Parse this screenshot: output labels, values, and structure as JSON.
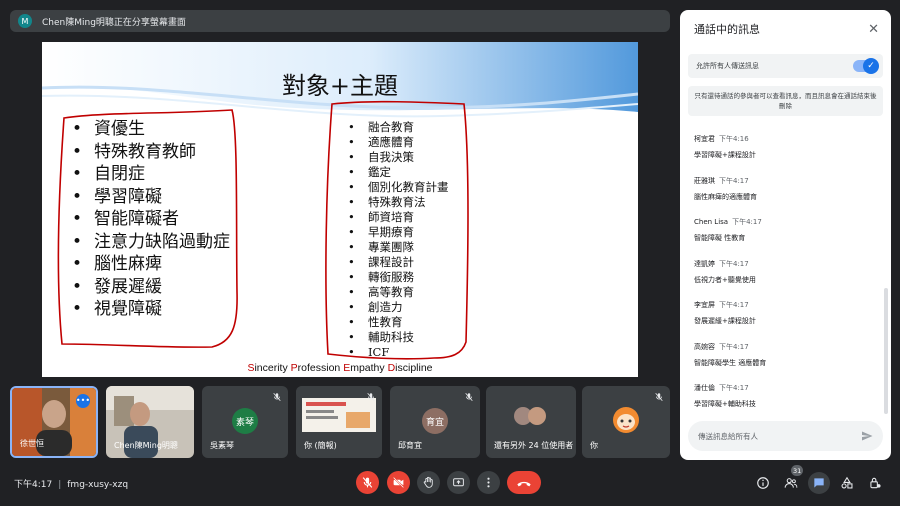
{
  "presenter": {
    "initial": "M",
    "text": "Chen陳Ming明聰正在分享螢幕畫面"
  },
  "slide": {
    "title": "對象+主題",
    "left_items": [
      "資優生",
      "特殊教育教師",
      "自閉症",
      "學習障礙",
      "智能障礙者",
      "注意力缺陷過動症",
      "腦性麻痺",
      "發展遲緩",
      "視覺障礙"
    ],
    "right_items": [
      "融合教育",
      "適應體育",
      "自我決策",
      "鑑定",
      "個別化教育計畫",
      "特殊教育法",
      "師資培育",
      "早期療育",
      "專業團隊",
      "課程設計",
      "轉銜服務",
      "高等教育",
      "創造力",
      "性教育",
      "輔助科技",
      "ICF"
    ],
    "footer": [
      {
        "initial": "S",
        "rest": "incerity"
      },
      {
        "initial": "P",
        "rest": "rofession"
      },
      {
        "initial": "E",
        "rest": "mpathy"
      },
      {
        "initial": "D",
        "rest": "iscipline"
      }
    ]
  },
  "chat": {
    "title": "通話中的訊息",
    "toggle_label": "允許所有人傳送訊息",
    "toggle_on": true,
    "notice": "只有還待通話的參與者可以查看訊息，而且訊息會在通話結束後刪除",
    "messages": [
      {
        "sender": "柯宜君",
        "time": "下午4:16",
        "text": "學習障礙+課程設計"
      },
      {
        "sender": "莊雅琪",
        "time": "下午4:17",
        "text": "腦性麻痺的適應體育"
      },
      {
        "sender": "Chen Lisa",
        "time": "下午4:17",
        "text": "智能障礙 性教育"
      },
      {
        "sender": "達凱婷",
        "time": "下午4:17",
        "text": "低視力者+聽覺使用"
      },
      {
        "sender": "李宜屏",
        "time": "下午4:17",
        "text": "發展遲緩+課程設計"
      },
      {
        "sender": "高婉容",
        "time": "下午4:17",
        "text": "智能障礙學生 適應體育"
      },
      {
        "sender": "潘仕倫",
        "time": "下午4:17",
        "text": "學習障礙+輔助科技"
      }
    ],
    "input_placeholder": "傳送訊息給所有人"
  },
  "participants": [
    {
      "name": "徐世恒",
      "type": "video"
    },
    {
      "name": "Chen陳Ming明聰",
      "type": "video"
    },
    {
      "name": "吳素琴",
      "avatar_text": "素琴",
      "avatar_color": "#1e7d45",
      "type": "avatar"
    },
    {
      "name": "你 (簡報)",
      "type": "screen"
    },
    {
      "name": "邱育宜",
      "avatar_text": "育宜",
      "avatar_color": "#8d6e63",
      "type": "avatar"
    },
    {
      "name": "還有另外 24 位使用者",
      "type": "group"
    },
    {
      "name": "你",
      "type": "self"
    }
  ],
  "bottom": {
    "time": "下午4:17",
    "meeting_code": "fmg-xusy-xzq",
    "people_count": "31"
  },
  "colors": {
    "end_call": "#ea4335",
    "accent": "#1a73e8",
    "ink": "#c00000"
  }
}
